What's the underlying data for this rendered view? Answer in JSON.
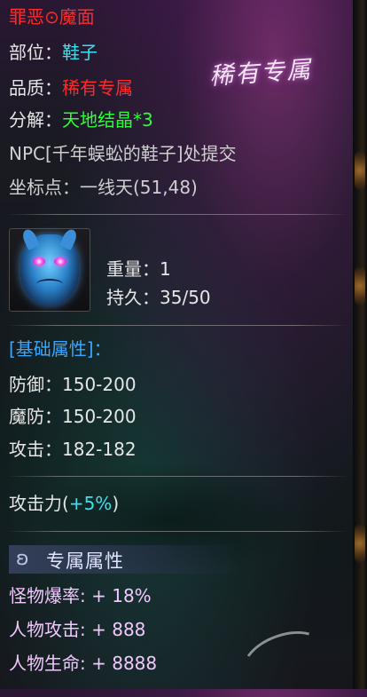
{
  "item": {
    "name": "罪恶⊙魔面",
    "badge": "稀有专属",
    "slot_label": "部位：",
    "slot_value": "鞋子",
    "quality_label": "品质：",
    "quality_value": "稀有专属",
    "decompose_label": "分解：",
    "decompose_value": "天地结晶*3",
    "npc_note": "NPC[千年蜈蚣的鞋子]处提交",
    "coord_label": "坐标点：",
    "coord_value": "一线天(51,48)",
    "weight_label": "重量：",
    "weight_value": "1",
    "durability_label": "持久：",
    "durability_value": "35/50",
    "icon": "demon-mask-icon"
  },
  "base_attrs": {
    "header": "[基础属性]：",
    "rows": [
      {
        "label": "防御：",
        "value": "150-200"
      },
      {
        "label": "魔防：",
        "value": "150-200"
      },
      {
        "label": "攻击：",
        "value": "182-182"
      }
    ]
  },
  "bonus": {
    "label": "攻击力(",
    "value": "+5%",
    "close": ")"
  },
  "exclusive": {
    "header": "专属属性",
    "icon": "wings-icon",
    "rows": [
      {
        "label": "怪物爆率:",
        "value": "+ 18%"
      },
      {
        "label": "人物攻击:",
        "value": "+ 888"
      },
      {
        "label": "人物生命:",
        "value": "+ 8888"
      }
    ]
  },
  "colors": {
    "title": "#ff2a2a",
    "slot": "#3be2ee",
    "quality": "#ff2a2a",
    "decompose": "#2bff37",
    "header": "#37a6ff",
    "bonus": "#3be2ee",
    "exclusive": "#f2c8ff"
  }
}
